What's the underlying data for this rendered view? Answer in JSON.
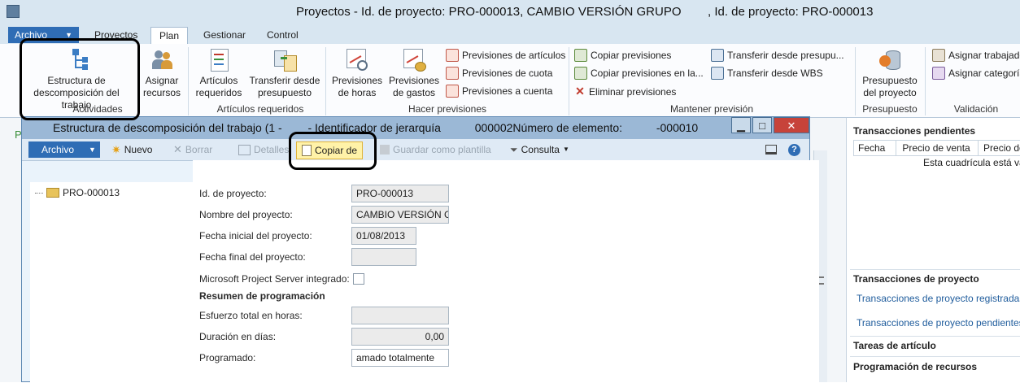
{
  "window": {
    "title": "Proyectos  - Id. de proyecto: PRO-000013, CAMBIO VERSIÓN GRUPO",
    "title_suffix": ", Id. de proyecto: PRO-000013"
  },
  "ribbon_tabs": {
    "file": "Archivo",
    "tabs": [
      "Proyectos",
      "Plan",
      "Gestionar",
      "Control"
    ],
    "active": "Plan"
  },
  "ribbon": {
    "wbs_button": "Estructura de descomposición del trabajo",
    "assign_resources": "Asignar recursos",
    "group_activities": "Actividades",
    "required_items": "Artículos requeridos",
    "transfer_budget": "Transferir desde presupuesto",
    "group_required_items": "Artículos requeridos",
    "hour_forecasts": "Previsiones de horas",
    "expense_forecasts": "Previsiones de gastos",
    "item_forecasts": "Previsiones de artículos",
    "fee_forecasts": "Previsiones de cuota",
    "on_account_forecasts": "Previsiones a cuenta",
    "group_make_forecasts": "Hacer previsiones",
    "copy_forecasts": "Copiar previsiones",
    "copy_forecasts_in": "Copiar previsiones en la...",
    "delete_forecasts": "Eliminar previsiones",
    "transfer_from_budget": "Transferir desde presupu...",
    "transfer_from_wbs": "Transferir desde WBS",
    "group_maintain": "Mantener previsión",
    "project_budget": "Presupuesto del proyecto",
    "group_budget": "Presupuesto",
    "assign_worker": "Asignar trabajado",
    "assign_category": "Asignar categoría",
    "group_validation": "Validación"
  },
  "right_pane": {
    "pending_title": "Transacciones pendientes",
    "columns": [
      "Fecha",
      "Precio de venta",
      "Precio de"
    ],
    "empty_text": "Esta cuadrícula está va",
    "project_tx_title": "Transacciones de proyecto",
    "posted_link": "Transacciones de proyecto registradas",
    "pending_link": "Transacciones de proyecto pendientes",
    "item_tasks": "Tareas de artículo",
    "resource_scheduling": "Programación de recursos"
  },
  "dialog": {
    "title": "Estructura de descomposición del trabajo (1 -",
    "title_mid": "- Identificador de jerarquía",
    "title_tail": "000002Número de elemento:",
    "title_end": "-000010",
    "toolbar": {
      "file": "Archivo",
      "new": "Nuevo",
      "delete": "Borrar",
      "details": "Detalles",
      "copy_from": "Copiar de",
      "save_template": "Guardar como plantilla",
      "query": "Consulta"
    },
    "tree_root": "PRO-000013",
    "form": {
      "project_id_label": "Id. de proyecto:",
      "project_id": "PRO-000013",
      "project_name_label": "Nombre del proyecto:",
      "project_name": "CAMBIO VERSIÓN G",
      "start_date_label": "Fecha inicial del proyecto:",
      "start_date": "01/08/2013",
      "end_date_label": "Fecha final del proyecto:",
      "end_date": "",
      "ms_project_label": "Microsoft Project Server integrado:",
      "schedule_summary": "Resumen de programación",
      "effort_label": "Esfuerzo total en horas:",
      "effort": "",
      "duration_label": "Duración en días:",
      "duration": "0,00",
      "scheduled_label": "Programado:",
      "scheduled": "amado totalmente"
    }
  },
  "colors": {
    "accent": "#2f6db5",
    "highlight": "#fff2a8"
  }
}
